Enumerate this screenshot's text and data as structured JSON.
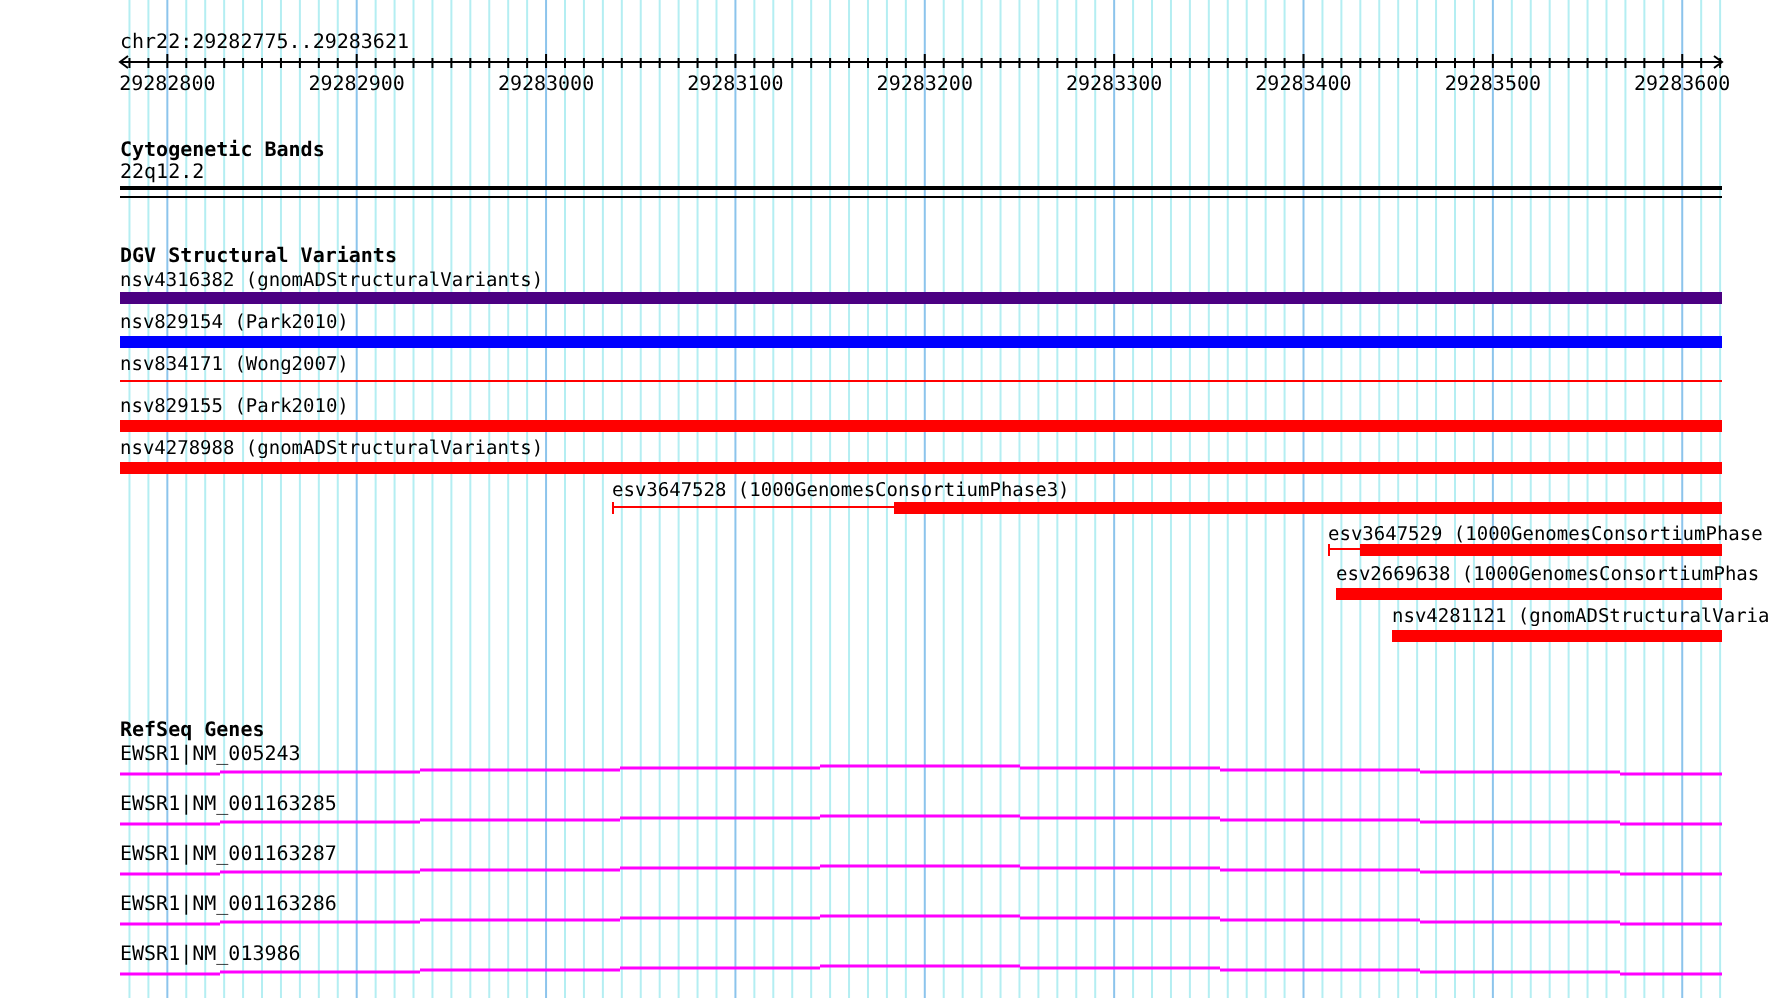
{
  "ruler": {
    "label": "chr22:29282775..29283621",
    "ticks": [
      "29282800",
      "29282900",
      "29283000",
      "29283100",
      "29283200",
      "29283300",
      "29283400",
      "29283500",
      "29283600"
    ]
  },
  "tracks": [
    {
      "title": "Cytogenetic Bands",
      "kind": "band",
      "features": [
        {
          "label": "22q12.2"
        }
      ]
    },
    {
      "title": "DGV Structural Variants",
      "kind": "variant",
      "features": [
        {
          "label": "nsv4316382 (gnomADStructuralVariants)",
          "color": "#4b0082"
        },
        {
          "label": "nsv829154 (Park2010)",
          "color": "#0000ff"
        },
        {
          "label": "nsv834171 (Wong2007)",
          "color": "#ff0000"
        },
        {
          "label": "nsv829155 (Park2010)",
          "color": "#ff0000"
        },
        {
          "label": "nsv4278988 (gnomADStructuralVariants)",
          "color": "#ff0000"
        },
        {
          "label": "esv3647528 (1000GenomesConsortiumPhase3)",
          "color": "#ff0000"
        },
        {
          "label": "esv3647529 (1000GenomesConsortiumPhase",
          "color": "#ff0000"
        },
        {
          "label": "esv2669638 (1000GenomesConsortiumPhas",
          "color": "#ff0000"
        },
        {
          "label": "nsv4281121 (gnomADStructuralVaria",
          "color": "#ff0000"
        }
      ]
    },
    {
      "title": "RefSeq Genes",
      "kind": "gene",
      "features": [
        {
          "label": "EWSR1|NM_005243"
        },
        {
          "label": "EWSR1|NM_001163285"
        },
        {
          "label": "EWSR1|NM_001163287"
        },
        {
          "label": "EWSR1|NM_001163286"
        },
        {
          "label": "EWSR1|NM_013986"
        }
      ]
    }
  ]
}
